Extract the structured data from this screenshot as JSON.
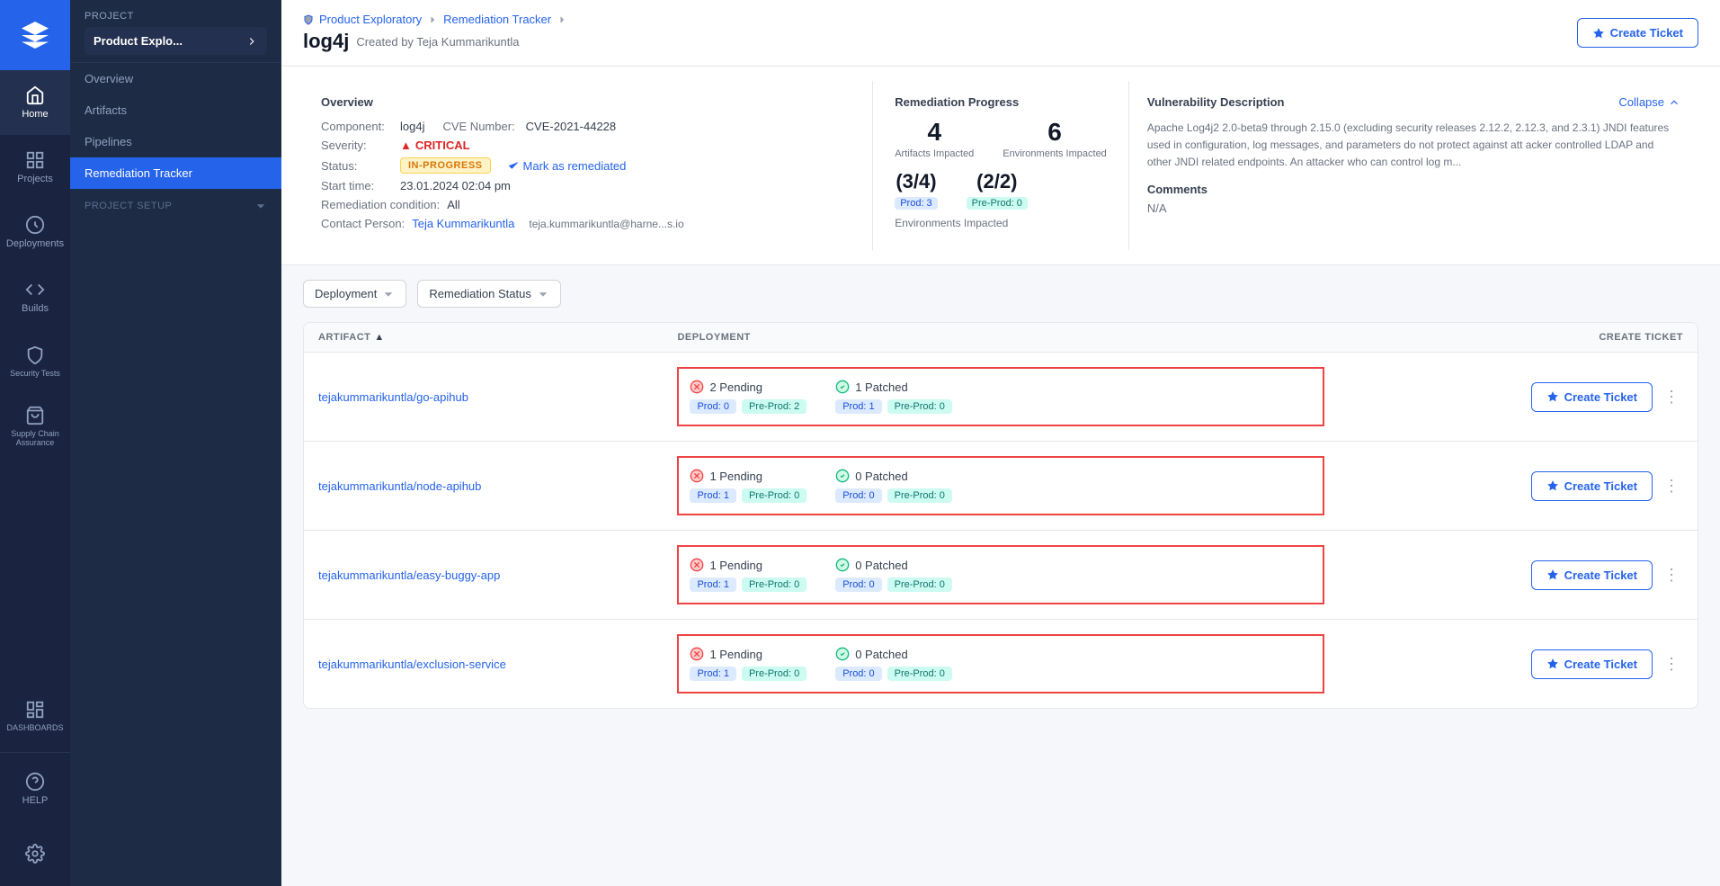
{
  "sidebar": {
    "logo_text": "Home",
    "items": [
      {
        "id": "home",
        "label": "Home",
        "active": true
      },
      {
        "id": "projects",
        "label": "Projects",
        "active": false
      },
      {
        "id": "deployments",
        "label": "Deployments",
        "active": false
      },
      {
        "id": "builds",
        "label": "Builds",
        "active": false
      },
      {
        "id": "security-tests",
        "label": "Security Tests",
        "active": false
      },
      {
        "id": "supply-chain",
        "label": "Supply Chain Assurance",
        "active": false
      },
      {
        "id": "dashboards",
        "label": "DASHBOARDS",
        "active": false
      },
      {
        "id": "help",
        "label": "HELP",
        "active": false
      }
    ]
  },
  "left_panel": {
    "project_label": "Project",
    "project_name": "Product Explo...",
    "nav_items": [
      {
        "id": "overview",
        "label": "Overview"
      },
      {
        "id": "artifacts",
        "label": "Artifacts"
      },
      {
        "id": "pipelines",
        "label": "Pipelines"
      },
      {
        "id": "remediation-tracker",
        "label": "Remediation Tracker",
        "active": true
      }
    ],
    "project_setup_label": "PROJECT SETUP"
  },
  "header": {
    "breadcrumb": [
      {
        "label": "Product Exploratory",
        "href": true
      },
      {
        "label": "Remediation Tracker",
        "href": true
      }
    ],
    "title": "log4j",
    "created_by": "Created by Teja Kummarikuntla",
    "create_ticket_label": "Create Ticket"
  },
  "overview": {
    "title": "Overview",
    "component_label": "Component:",
    "component_value": "log4j",
    "cve_label": "CVE Number:",
    "cve_value": "CVE-2021-44228",
    "severity_label": "Severity:",
    "severity_value": "CRITICAL",
    "status_label": "Status:",
    "status_value": "IN-PROGRESS",
    "mark_remediated": "Mark as remediated",
    "start_time_label": "Start time:",
    "start_time_value": "23.01.2024 02:04 pm",
    "remediation_condition_label": "Remediation condition:",
    "remediation_condition_value": "All",
    "contact_person_label": "Contact Person:",
    "contact_name": "Teja Kummarikuntla",
    "contact_email": "teja.kummarikuntla@harne...s.io"
  },
  "remediation_progress": {
    "title": "Remediation Progress",
    "artifacts_impacted": "4",
    "artifacts_label": "Artifacts Impacted",
    "environments_impacted": "6",
    "environments_label": "Environments Impacted",
    "prod_fraction": "(3/4)",
    "prod_label": "Prod: 3",
    "preprod_fraction": "(2/2)",
    "preprod_label": "Pre-Prod: 0",
    "env_impacted_label": "Environments Impacted"
  },
  "vulnerability": {
    "title": "Vulnerability Description",
    "collapse_label": "Collapse",
    "description": "Apache Log4j2 2.0-beta9 through 2.15.0 (excluding security releases 2.12.2, 2.12.3, and 2.3.1) JNDI features used in configuration, log messages, and parameters do not protect against att acker controlled LDAP and other JNDI related endpoints. An attacker who can control log m...",
    "comments_title": "Comments",
    "comments_value": "N/A"
  },
  "filters": {
    "deployment_label": "Deployment",
    "remediation_status_label": "Remediation Status"
  },
  "table": {
    "col_artifact": "ARTIFACT",
    "col_deployment": "DEPLOYMENT",
    "col_create_ticket": "CREATE TICKET",
    "rows": [
      {
        "artifact": "tejakummarikuntla/go-apihub",
        "pending_count": "2 Pending",
        "pending_prod": "Prod: 0",
        "pending_preprod": "Pre-Prod: 2",
        "patched_count": "1 Patched",
        "patched_prod": "Prod: 1",
        "patched_preprod": "Pre-Prod: 0",
        "create_ticket": "Create Ticket"
      },
      {
        "artifact": "tejakummarikuntla/node-apihub",
        "pending_count": "1 Pending",
        "pending_prod": "Prod: 1",
        "pending_preprod": "Pre-Prod: 0",
        "patched_count": "0 Patched",
        "patched_prod": "Prod: 0",
        "patched_preprod": "Pre-Prod: 0",
        "create_ticket": "Create Ticket"
      },
      {
        "artifact": "tejakummarikuntla/easy-buggy-app",
        "pending_count": "1 Pending",
        "pending_prod": "Prod: 1",
        "pending_preprod": "Pre-Prod: 0",
        "patched_count": "0 Patched",
        "patched_prod": "Prod: 0",
        "patched_preprod": "Pre-Prod: 0",
        "create_ticket": "Create Ticket"
      },
      {
        "artifact": "tejakummarikuntla/exclusion-service",
        "pending_count": "1 Pending",
        "pending_prod": "Prod: 1",
        "pending_preprod": "Pre-Prod: 0",
        "patched_count": "0 Patched",
        "patched_prod": "Prod: 0",
        "patched_preprod": "Pre-Prod: 0",
        "create_ticket": "Create Ticket"
      }
    ]
  },
  "colors": {
    "primary": "#2563eb",
    "critical": "#dc2626",
    "sidebar_bg": "#1a2340",
    "accent_red": "#ef4444"
  }
}
